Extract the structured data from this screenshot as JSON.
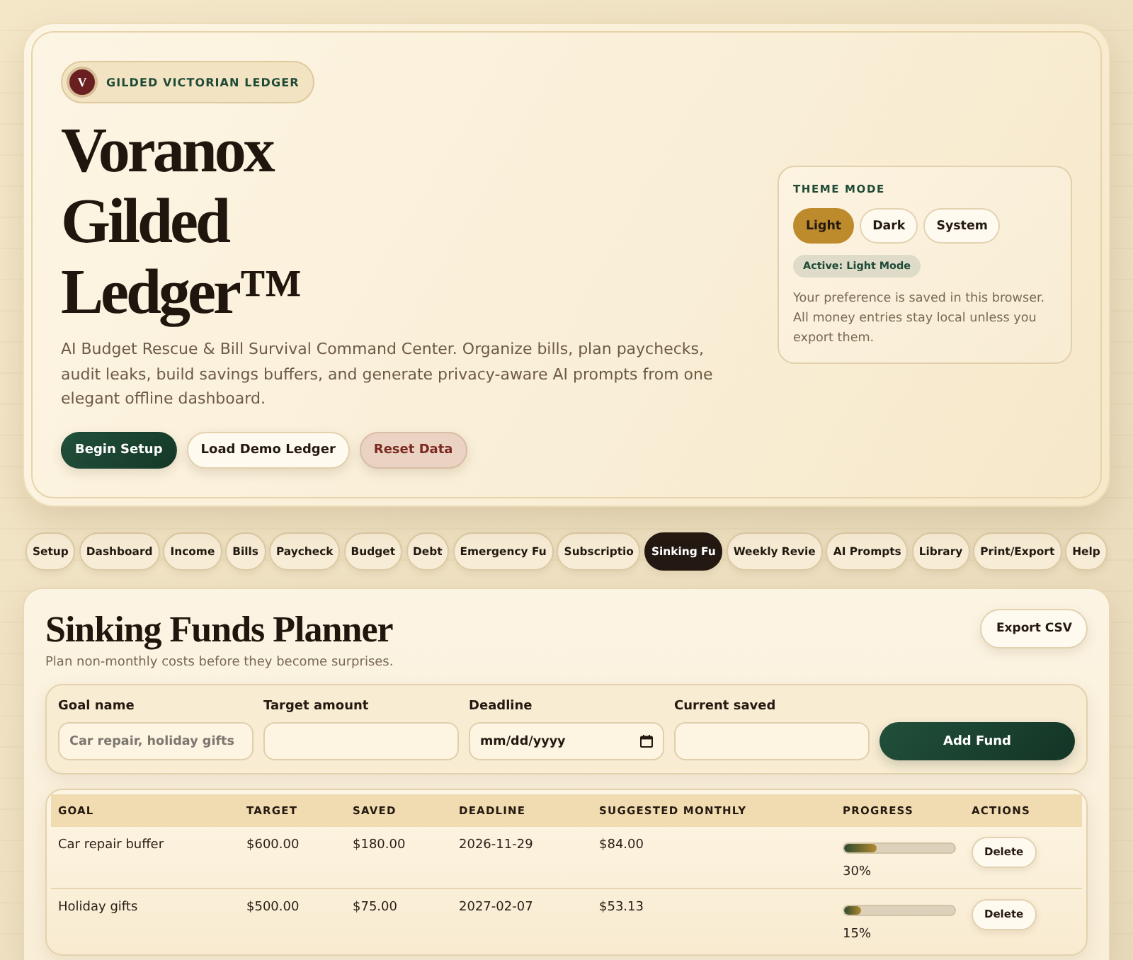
{
  "brand": {
    "monogram": "V",
    "label": "GILDED VICTORIAN LEDGER"
  },
  "hero": {
    "title": "Voranox Gilded Ledger™",
    "description": "AI Budget Rescue & Bill Survival Command Center. Organize bills, plan paychecks, audit leaks, build savings buffers, and generate privacy-aware AI prompts from one elegant offline dashboard.",
    "buttons": [
      {
        "label": "Begin Setup",
        "kind": "primary"
      },
      {
        "label": "Load Demo Ledger",
        "kind": "secondary"
      },
      {
        "label": "Reset Data",
        "kind": "danger"
      }
    ]
  },
  "theme_panel": {
    "heading": "THEME MODE",
    "options": [
      {
        "label": "Light",
        "selected": true
      },
      {
        "label": "Dark",
        "selected": false
      },
      {
        "label": "System",
        "selected": false
      }
    ],
    "status": "Active: Light Mode",
    "note": "Your preference is saved in this browser. All money entries stay local unless you export them."
  },
  "tabs": [
    {
      "label": "Setup",
      "selected": false
    },
    {
      "label": "Dashboard",
      "selected": false
    },
    {
      "label": "Income",
      "selected": false
    },
    {
      "label": "Bills",
      "selected": false
    },
    {
      "label": "Paycheck",
      "selected": false
    },
    {
      "label": "Budget",
      "selected": false
    },
    {
      "label": "Debt",
      "selected": false
    },
    {
      "label": "Emergency Fu",
      "selected": false
    },
    {
      "label": "Subscriptio",
      "selected": false
    },
    {
      "label": "Sinking Fu",
      "selected": true
    },
    {
      "label": "Weekly Revie",
      "selected": false
    },
    {
      "label": "AI Prompts",
      "selected": false
    },
    {
      "label": "Library",
      "selected": false
    },
    {
      "label": "Print/Export",
      "selected": false
    },
    {
      "label": "Help",
      "selected": false
    }
  ],
  "section": {
    "title": "Sinking Funds Planner",
    "subtitle": "Plan non-monthly costs before they become surprises.",
    "export_button": "Export CSV",
    "form": {
      "fields": [
        {
          "label": "Goal name",
          "kind": "text",
          "placeholder": "Car repair, holiday gifts"
        },
        {
          "label": "Target amount",
          "kind": "text"
        },
        {
          "label": "Deadline",
          "kind": "date",
          "placeholder": "mm/dd/yyyy"
        },
        {
          "label": "Current saved",
          "kind": "text"
        }
      ],
      "submit": "Add Fund"
    },
    "table": {
      "columns": [
        "GOAL",
        "TARGET",
        "SAVED",
        "DEADLINE",
        "SUGGESTED MONTHLY",
        "PROGRESS",
        "ACTIONS"
      ],
      "rows": [
        {
          "goal": "Car repair buffer",
          "target": "$600.00",
          "saved": "$180.00",
          "deadline": "2026-11-29",
          "monthly": "$84.00",
          "level": 0.3,
          "percent": "30%",
          "action": "Delete"
        },
        {
          "goal": "Holiday gifts",
          "target": "$500.00",
          "saved": "$75.00",
          "deadline": "2027-02-07",
          "monthly": "$53.13",
          "level": 0.15,
          "percent": "15%",
          "action": "Delete"
        }
      ]
    }
  }
}
